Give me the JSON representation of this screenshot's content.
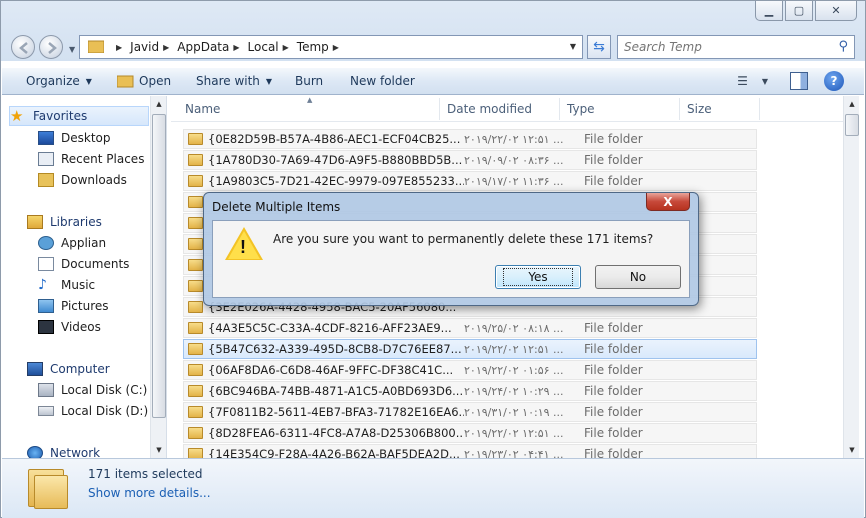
{
  "address": {
    "crumbs": [
      "Javid",
      "AppData",
      "Local",
      "Temp"
    ]
  },
  "search": {
    "placeholder": "Search Temp"
  },
  "toolbar": {
    "organize": "Organize",
    "open": "Open",
    "share_with": "Share with",
    "burn": "Burn",
    "new_folder": "New folder"
  },
  "nav": {
    "favorites": "Favorites",
    "desktop": "Desktop",
    "recent_places": "Recent Places",
    "downloads": "Downloads",
    "libraries": "Libraries",
    "applian": "Applian",
    "documents": "Documents",
    "music": "Music",
    "pictures": "Pictures",
    "videos": "Videos",
    "computer": "Computer",
    "local_disk_c": "Local Disk (C:)",
    "local_disk_d": "Local Disk (D:)",
    "network": "Network"
  },
  "columns": {
    "name": "Name",
    "date_modified": "Date modified",
    "type": "Type",
    "size": "Size"
  },
  "files": [
    {
      "name": "{0E82D59B-B57A-4B86-AEC1-ECF04CB25...",
      "date": "۲۰۱۹/۲۲/۰۲ ۱۲:۵۱ ...",
      "type": "File folder"
    },
    {
      "name": "{1A780D30-7A69-47D6-A9F5-B880BBD5B...",
      "date": "۲۰۱۹/۰۹/۰۲ ۰۸:۳۶ ...",
      "type": "File folder"
    },
    {
      "name": "{1A9803C5-7D21-42EC-9979-097E855233...",
      "date": "۲۰۱۹/۱۷/۰۲ ۱۱:۳۶ ...",
      "type": "File folder"
    },
    {
      "name": "",
      "date": "",
      "type": ""
    },
    {
      "name": "",
      "date": "",
      "type": ""
    },
    {
      "name": "",
      "date": "",
      "type": ""
    },
    {
      "name": "",
      "date": "",
      "type": ""
    },
    {
      "name": "",
      "date": "",
      "type": ""
    },
    {
      "name": "{3E2E026A-4428-4958-BAC5-20AF56080...",
      "date": "",
      "type": ""
    },
    {
      "name": "{4A3E5C5C-C33A-4CDF-8216-AFF23AE9...",
      "date": "۲۰۱۹/۲۵/۰۲ ۰۸:۱۸ ...",
      "type": "File folder"
    },
    {
      "name": "{5B47C632-A339-495D-8CB8-D7C76EE87...",
      "date": "۲۰۱۹/۲۲/۰۲ ۱۲:۵۱ ...",
      "type": "File folder"
    },
    {
      "name": "{06AF8DA6-C6D8-46AF-9FFC-DF38C41C...",
      "date": "۲۰۱۹/۲۲/۰۲ ۰۱:۵۶ ...",
      "type": "File folder"
    },
    {
      "name": "{6BC946BA-74BB-4871-A1C5-A0BD693D6...",
      "date": "۲۰۱۹/۲۴/۰۲ ۱۰:۲۹ ...",
      "type": "File folder"
    },
    {
      "name": "{7F0811B2-5611-4EB7-BFA3-71782E16EA6...",
      "date": "۲۰۱۹/۳۱/۰۲ ۱۰:۱۹ ...",
      "type": "File folder"
    },
    {
      "name": "{8D28FEA6-6311-4FC8-A7A8-D25306B800...",
      "date": "۲۰۱۹/۲۲/۰۲ ۱۲:۵۱ ...",
      "type": "File folder"
    },
    {
      "name": "{14E354C9-F28A-4A26-B62A-BAF5DEA2D...",
      "date": "۲۰۱۹/۲۳/۰۲ ۰۴:۴۱ ...",
      "type": "File folder"
    }
  ],
  "selected_row_index": 10,
  "details": {
    "count": "171 items selected",
    "show_more": "Show more details..."
  },
  "dialog": {
    "title": "Delete Multiple Items",
    "message": "Are you sure you want to permanently delete these 171 items?",
    "yes": "Yes",
    "no": "No",
    "close_glyph": "X",
    "icon": "warning-icon"
  },
  "icons": {
    "back": "back-arrow-icon",
    "forward": "forward-arrow-icon",
    "refresh": "refresh-icon",
    "search": "search-icon",
    "help": "help-icon"
  },
  "colors": {
    "accent": "#3c7fb1",
    "close_red": "#c7493a",
    "link": "#1a5fb4"
  }
}
